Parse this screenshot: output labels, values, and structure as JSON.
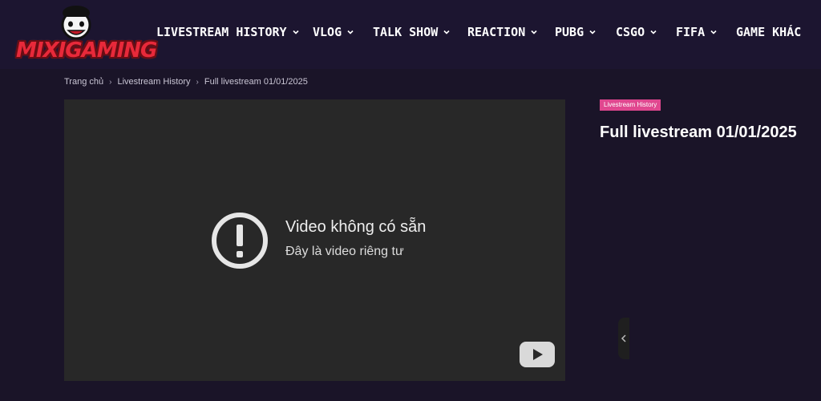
{
  "site": {
    "logo_text": "MIXIGAMING"
  },
  "nav": {
    "items": [
      {
        "label": "LIVESTREAM HISTORY",
        "has_dropdown": true
      },
      {
        "label": "VLOG",
        "has_dropdown": true
      },
      {
        "label": "TALK SHOW",
        "has_dropdown": true
      },
      {
        "label": "REACTION",
        "has_dropdown": true
      },
      {
        "label": "PUBG",
        "has_dropdown": true
      },
      {
        "label": "CSGO",
        "has_dropdown": true
      },
      {
        "label": "FIFA",
        "has_dropdown": true
      },
      {
        "label": "GAME KHÁC",
        "has_dropdown": false
      }
    ]
  },
  "breadcrumb": {
    "home": "Trang chủ",
    "category": "Livestream History",
    "current": "Full livestream 01/01/2025"
  },
  "player": {
    "error_title": "Video không có sẵn",
    "error_subtitle": "Đây là video riêng tư",
    "icons": [
      "alert-circle-icon",
      "youtube-icon",
      "chevron-left-icon"
    ]
  },
  "post": {
    "category_badge": "Livestream History",
    "title": "Full livestream 01/01/2025"
  },
  "colors": {
    "background": "#1a1428",
    "header": "#1c1530",
    "player_bg": "#282828",
    "badge": "#e0478f",
    "logo_red": "#e8293a"
  }
}
